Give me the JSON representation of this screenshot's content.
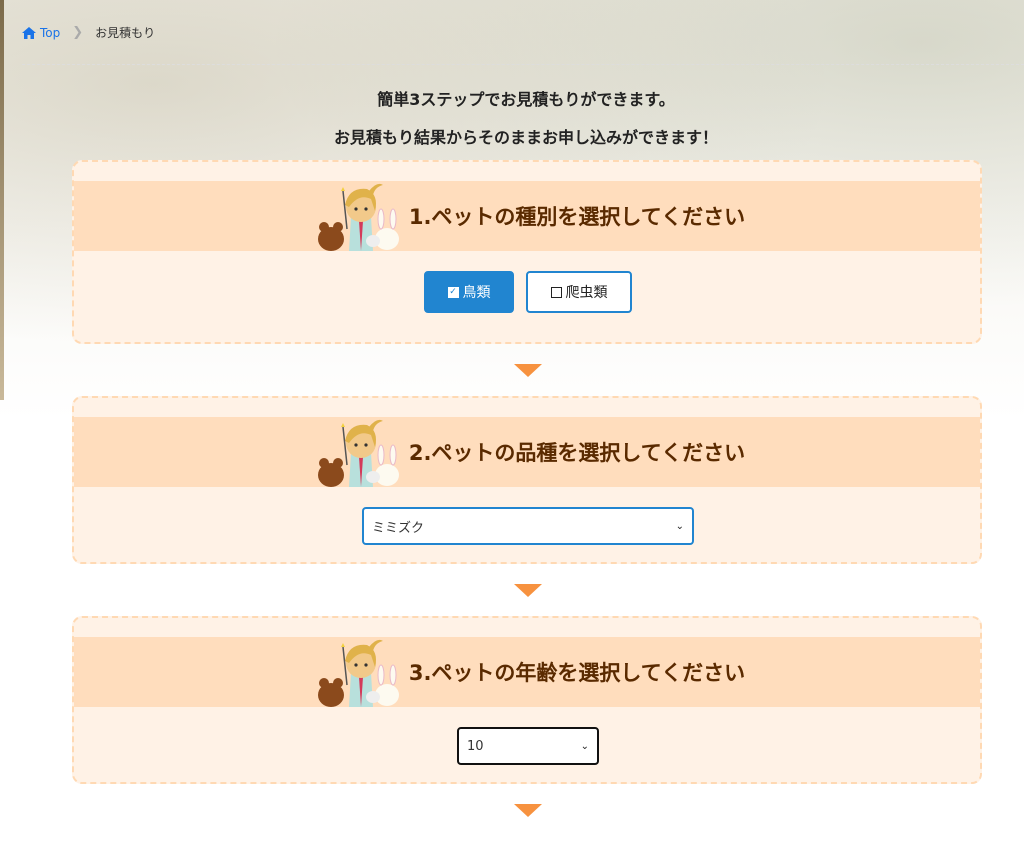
{
  "breadcrumb": {
    "home": "Top",
    "current": "お見積もり"
  },
  "intro": {
    "line1": "簡単3ステップでお見積もりができます。",
    "line2": "お見積もり結果からそのままお申し込みができます！"
  },
  "steps": [
    {
      "title": "1.ペットの種別を選択してください",
      "options": [
        {
          "label": "鳥類",
          "selected": true
        },
        {
          "label": "爬虫類",
          "selected": false
        }
      ]
    },
    {
      "title": "2.ペットの品種を選択してください",
      "select_value": "ミミズク"
    },
    {
      "title": "3.ペットの年齢を選択してください",
      "select_value": "10"
    }
  ],
  "colors": {
    "accent": "#2185d0",
    "step_header": "#ffddbd",
    "step_bg": "#fff2e6",
    "arrow": "#f7923f",
    "title_text": "#5a2a00"
  },
  "icons": {
    "home": "home-icon",
    "chevron": "chevron-right-icon",
    "select": "chevron-down-icon"
  }
}
